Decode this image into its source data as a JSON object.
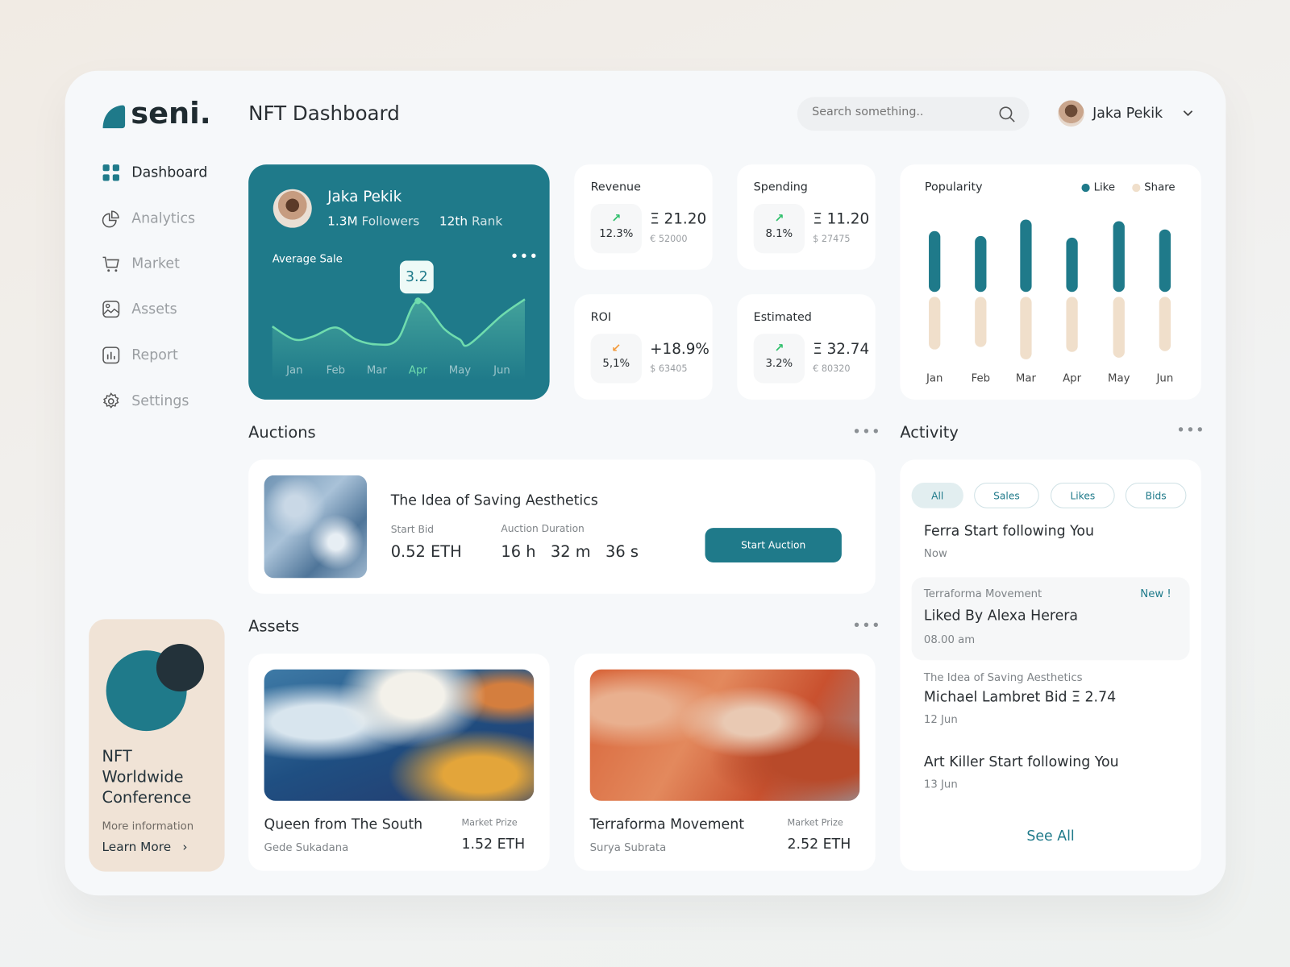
{
  "brand": {
    "name": "seni.",
    "color": "#1f7a8a"
  },
  "header": {
    "title": "NFT Dashboard",
    "search_placeholder": "Search something..",
    "user": "Jaka Pekik"
  },
  "sidebar": {
    "items": [
      {
        "label": "Dashboard",
        "icon": "grid-icon",
        "active": true
      },
      {
        "label": "Analytics",
        "icon": "pie-chart-icon"
      },
      {
        "label": "Market",
        "icon": "cart-icon"
      },
      {
        "label": "Assets",
        "icon": "image-icon"
      },
      {
        "label": "Report",
        "icon": "bar-chart-icon"
      },
      {
        "label": "Settings",
        "icon": "gear-icon"
      }
    ],
    "promo": {
      "title_lines": [
        "NFT",
        "Worldwide",
        "Conference"
      ],
      "subtitle": "More information",
      "link": "Learn More"
    }
  },
  "profile": {
    "name": "Jaka Pekik",
    "followers_value": "1.3M",
    "followers_label": "Followers",
    "rank_value": "12th",
    "rank_label": "Rank",
    "chart_title": "Average Sale",
    "tooltip": "3.2"
  },
  "chart_data": [
    {
      "type": "area",
      "title": "Average Sale",
      "categories": [
        "Jan",
        "Feb",
        "Mar",
        "Apr",
        "May",
        "Jun"
      ],
      "values": [
        1.6,
        2.1,
        1.4,
        3.2,
        1.6,
        2.6
      ],
      "highlight": "Apr",
      "highlight_label": "3.2"
    },
    {
      "type": "bar",
      "title": "Popularity",
      "categories": [
        "Jan",
        "Feb",
        "Mar",
        "Apr",
        "May",
        "Jun"
      ],
      "series": [
        {
          "name": "Like",
          "color": "#1f7a8a",
          "values": [
            74,
            68,
            88,
            66,
            86,
            76
          ]
        },
        {
          "name": "Share",
          "color": "#f0dfcb",
          "values": [
            64,
            61,
            76,
            67,
            74,
            66
          ]
        }
      ],
      "legend": "top-right"
    }
  ],
  "stats": [
    {
      "title": "Revenue",
      "trend": "up",
      "pct": "12.3%",
      "value": "Ξ 21.20",
      "sub": "€ 52000"
    },
    {
      "title": "Spending",
      "trend": "up",
      "pct": "8.1%",
      "value": "Ξ 11.20",
      "sub": "$ 27475"
    },
    {
      "title": "ROI",
      "trend": "down",
      "pct": "5,1%",
      "value": "+18.9%",
      "sub": "$ 63405"
    },
    {
      "title": "Estimated",
      "trend": "up",
      "pct": "3.2%",
      "value": "Ξ 32.74",
      "sub": "€ 80320"
    }
  ],
  "auctions": {
    "title": "Auctions",
    "item": {
      "name": "The Idea of Saving Aesthetics",
      "start_bid_label": "Start Bid",
      "start_bid": "0.52 ETH",
      "duration_label": "Auction Duration",
      "h": "16 h",
      "m": "32 m",
      "s": "36 s",
      "button": "Start Auction"
    }
  },
  "assets": {
    "title": "Assets",
    "items": [
      {
        "name": "Queen from The South",
        "artist": "Gede Sukadana",
        "price_label": "Market Prize",
        "price": "1.52 ETH"
      },
      {
        "name": "Terraforma Movement",
        "artist": "Surya Subrata",
        "price_label": "Market Prize",
        "price": "2.52 ETH"
      }
    ]
  },
  "activity": {
    "title": "Activity",
    "filters": [
      "All",
      "Sales",
      "Likes",
      "Bids"
    ],
    "active_filter": "All",
    "items": [
      {
        "pre": "",
        "title": "Ferra Start following You",
        "time": "Now"
      },
      {
        "pre": "Terraforma Movement",
        "badge": "New !",
        "title": "Liked By Alexa Herera",
        "time": "08.00 am"
      },
      {
        "pre": "The Idea of Saving Aesthetics",
        "title": "Michael Lambret Bid Ξ 2.74",
        "time": "12 Jun"
      },
      {
        "pre": "",
        "title": "Art Killer Start following You",
        "time": "13 Jun"
      }
    ],
    "see_all": "See All"
  },
  "colors": {
    "accent": "#1f7a8a",
    "up": "#2dbf6a",
    "down": "#f39a3b",
    "promo_bg": "#f0e3d6"
  }
}
